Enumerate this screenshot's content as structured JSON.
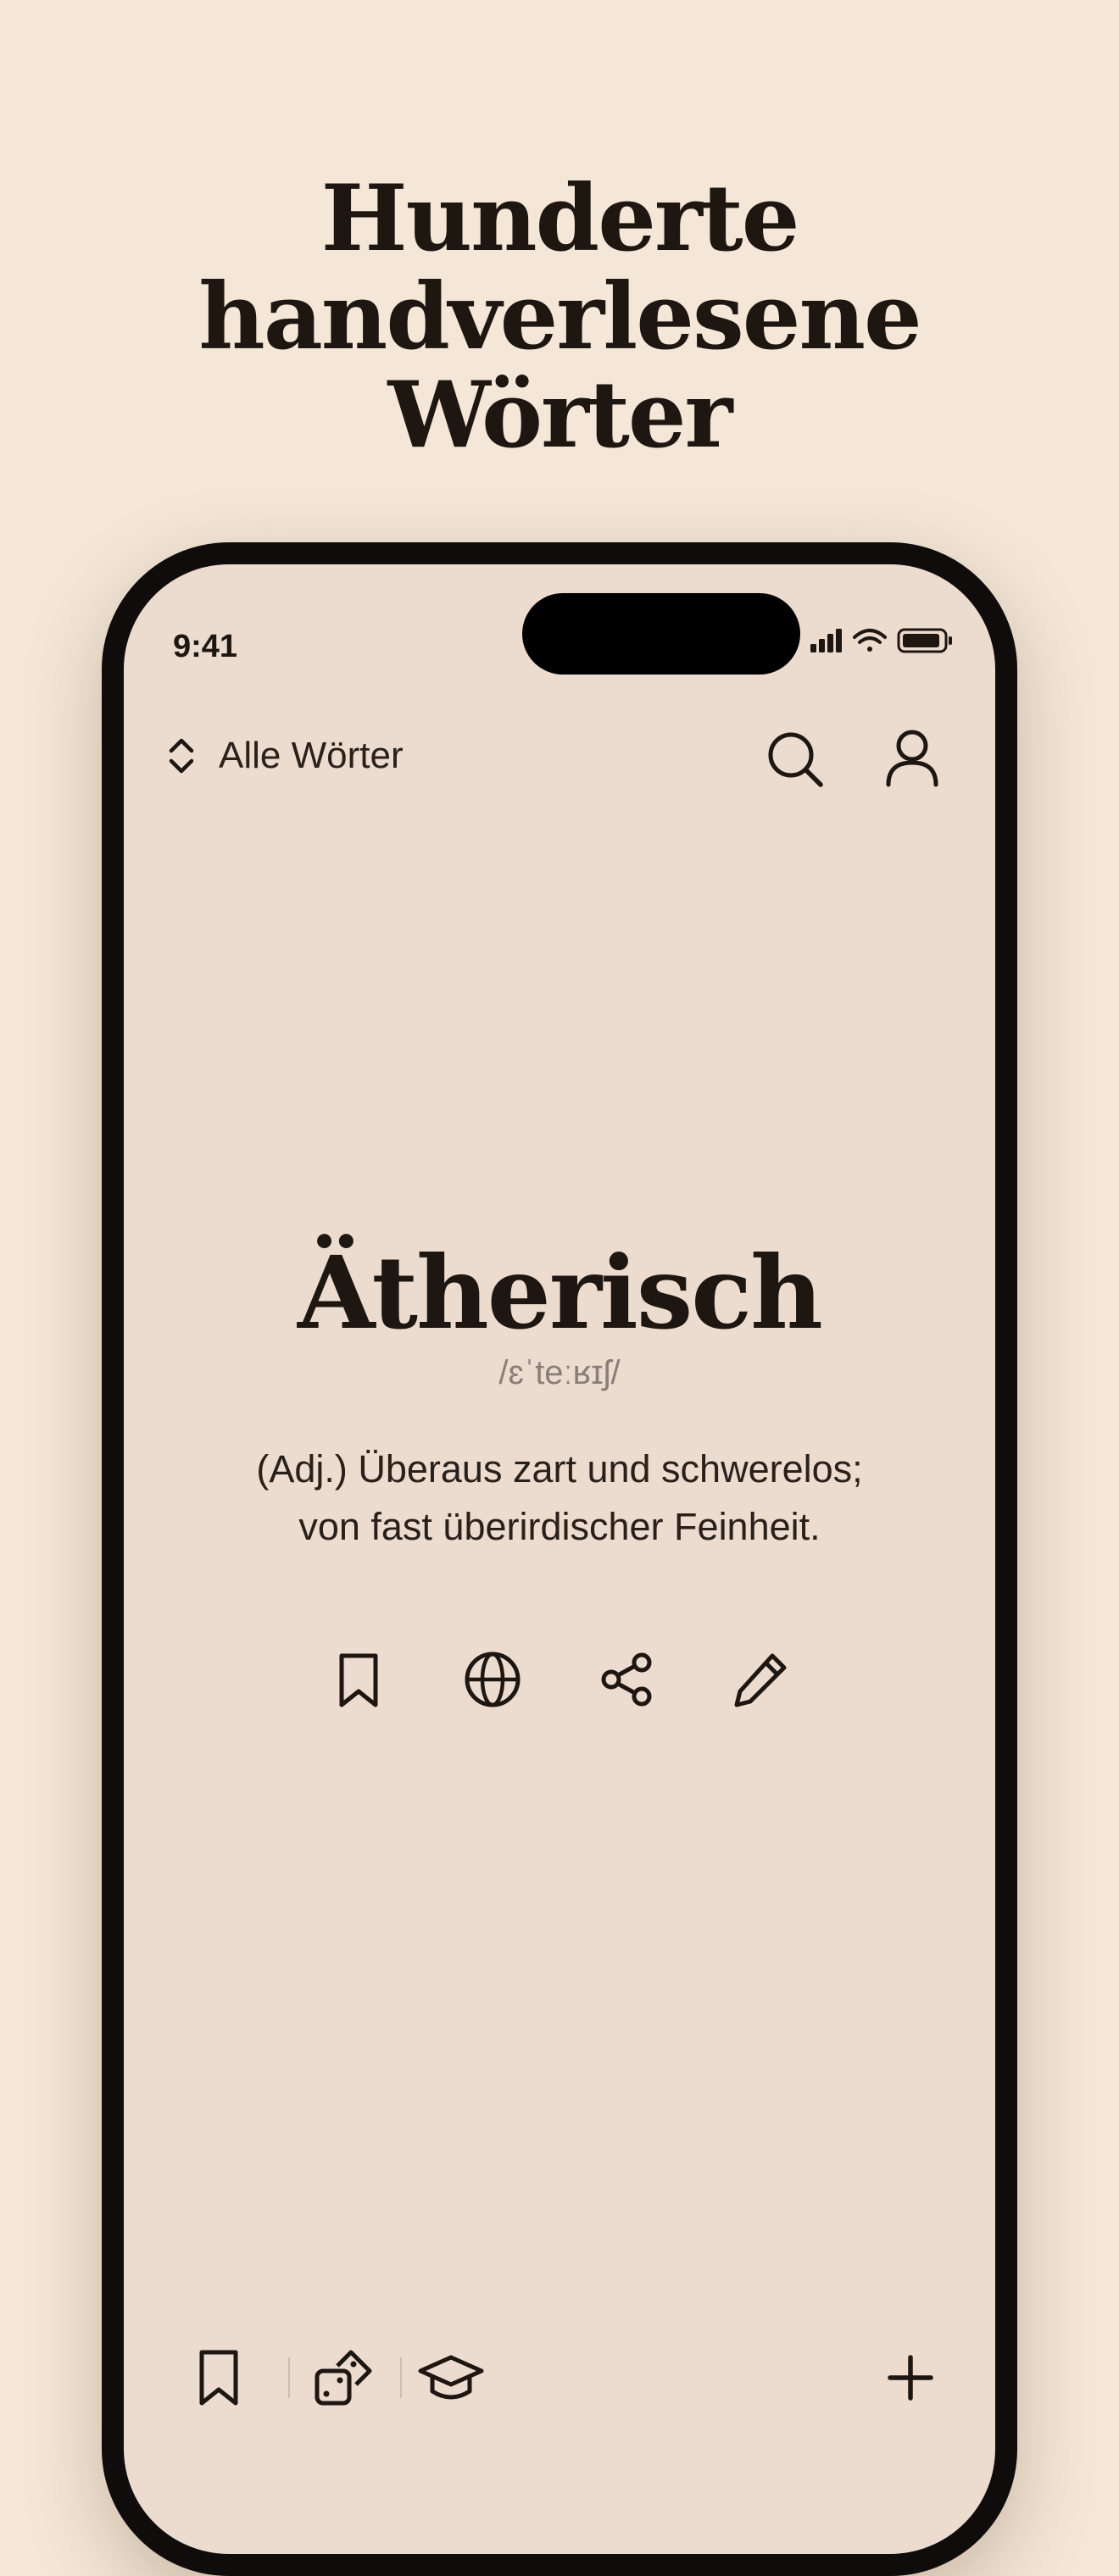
{
  "headline": {
    "line1": "Hunderte handverlesene",
    "line2": "Wörter"
  },
  "status_bar": {
    "time": "9:41",
    "icons": [
      "signal-icon",
      "wifi-icon",
      "battery-icon"
    ]
  },
  "topbar": {
    "filter_label": "Alle Wörter",
    "filter_icon": "chevron-up-down-icon",
    "search_icon": "search-icon",
    "profile_icon": "user-icon"
  },
  "word": {
    "title": "Ätherisch",
    "phonetic": "/ɛˈteːʁɪʃ/",
    "definition_line1": "(Adj.) Überaus zart und schwerelos;",
    "definition_line2": "von fast überirdischer Feinheit."
  },
  "actions": [
    "bookmark-icon",
    "globe-icon",
    "share-icon",
    "pencil-icon"
  ],
  "bottombar": {
    "items": [
      "bookmark-icon",
      "dice-icon",
      "graduation-cap-icon"
    ],
    "add_icon": "plus-icon"
  },
  "colors": {
    "page_background": "#f4e7d8",
    "screen_background": "#ecdbcf",
    "text": "#1e1611",
    "phonetic": "#8a7f78",
    "phone_frame": "#0f0c0b"
  }
}
